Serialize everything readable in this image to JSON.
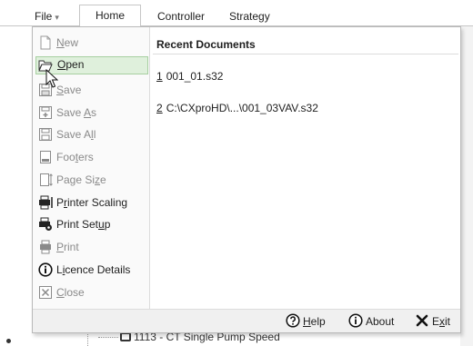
{
  "ribbon": {
    "file_label": "File",
    "file_caret": "▾",
    "tabs": [
      {
        "label": "Home"
      },
      {
        "label": "Controller"
      },
      {
        "label": "Strategy"
      }
    ]
  },
  "menu": {
    "items": [
      {
        "pre": "",
        "ul": "N",
        "post": "ew",
        "icon": "new-document-icon",
        "enabled": false
      },
      {
        "pre": "",
        "ul": "O",
        "post": "pen",
        "icon": "open-folder-icon",
        "enabled": true,
        "hover": true
      },
      {
        "pre": "",
        "ul": "S",
        "post": "ave",
        "icon": "save-icon",
        "enabled": false
      },
      {
        "pre": "Save ",
        "ul": "A",
        "post": "s",
        "icon": "save-as-icon",
        "enabled": false
      },
      {
        "pre": "Save A",
        "ul": "l",
        "post": "l",
        "icon": "save-all-icon",
        "enabled": false
      },
      {
        "pre": "Foo",
        "ul": "t",
        "post": "ers",
        "icon": "footers-icon",
        "enabled": false
      },
      {
        "pre": "Page Si",
        "ul": "z",
        "post": "e",
        "icon": "page-size-icon",
        "enabled": false
      },
      {
        "pre": "P",
        "ul": "r",
        "post": "inter Scaling",
        "icon": "printer-scaling-icon",
        "enabled": true
      },
      {
        "pre": "Print Set",
        "ul": "u",
        "post": "p",
        "icon": "print-setup-icon",
        "enabled": true
      },
      {
        "pre": "",
        "ul": "P",
        "post": "rint",
        "icon": "print-icon",
        "enabled": false
      },
      {
        "pre": "L",
        "ul": "i",
        "post": "cence Details",
        "icon": "info-circle-icon",
        "enabled": true
      },
      {
        "pre": "",
        "ul": "C",
        "post": "lose",
        "icon": "close-document-icon",
        "enabled": false
      }
    ],
    "recent_title": "Recent Documents",
    "recent": [
      {
        "num": "1",
        "path": "001_01.s32"
      },
      {
        "num": "2",
        "path": "C:\\CXproHD\\...\\001_03VAV.s32"
      }
    ],
    "footer": {
      "help_ul": "H",
      "help_rest": "elp",
      "about": "About",
      "exit_pre": "E",
      "exit_ul": "x",
      "exit_post": "it"
    }
  },
  "background": {
    "tree_item": "1113 - CT Single Pump Speed"
  },
  "colors": {
    "hover_bg": "#dff0dc",
    "hover_border": "#a6cfa0",
    "disabled_text": "#8a8a8a"
  }
}
